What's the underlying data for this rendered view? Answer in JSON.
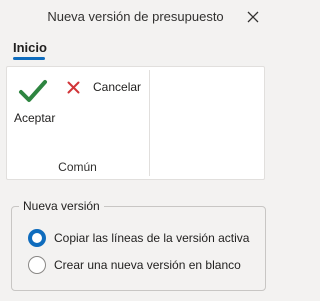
{
  "dialog": {
    "title": "Nueva versión de presupuesto",
    "close_icon": "close-icon"
  },
  "tabs": [
    {
      "label": "Inicio",
      "selected": true
    }
  ],
  "ribbon": {
    "accept": {
      "label": "Aceptar",
      "icon": "checkmark-icon",
      "color": "#2e8540"
    },
    "cancel": {
      "label": "Cancelar",
      "icon": "x-icon",
      "color": "#d13438"
    },
    "group_label": "Común"
  },
  "new_version": {
    "legend": "Nueva versión",
    "options": [
      {
        "label": "Copiar las líneas de la versión activa",
        "selected": true
      },
      {
        "label": "Crear una nueva versión en blanco",
        "selected": false
      }
    ]
  },
  "colors": {
    "accent": "#0f6cbd"
  }
}
